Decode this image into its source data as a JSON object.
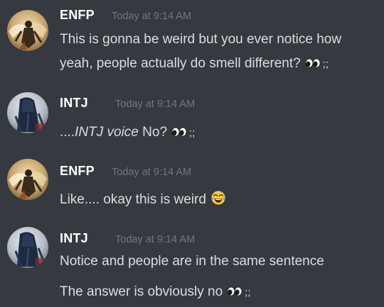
{
  "messages": [
    {
      "author": "ENFP",
      "timestamp": "Today at 9:14 AM",
      "avatar": "enfp-avatar",
      "lines": [
        {
          "text": "This is gonna be weird but you ever notice how"
        },
        {
          "text": "yeah, people actually do smell different?",
          "emoji": "eyes-icon",
          "suffix": ";;"
        }
      ]
    },
    {
      "author": "INTJ",
      "timestamp": "Today at 9:14 AM",
      "avatar": "intj-avatar",
      "lines": [
        {
          "prefix": "....",
          "italic": "INTJ voice",
          "text": " No?",
          "emoji": "eyes-icon",
          "suffix": ";;"
        }
      ]
    },
    {
      "author": "ENFP",
      "timestamp": "Today at 9:14 AM",
      "avatar": "enfp-avatar",
      "lines": [
        {
          "text": "Like.... okay this is weird",
          "emoji": "tears-of-joy-icon"
        }
      ]
    },
    {
      "author": "INTJ",
      "timestamp": "Today at 9:14 AM",
      "avatar": "intj-avatar",
      "lines": [
        {
          "text": "Notice and people are in the same sentence"
        },
        {
          "text": "The answer is obviously no",
          "emoji": "eyes-icon",
          "suffix": ";;"
        }
      ]
    }
  ],
  "colors": {
    "background": "#36393f",
    "username": "#ffffff",
    "message_text": "#dcddde",
    "timestamp": "#72767d"
  }
}
